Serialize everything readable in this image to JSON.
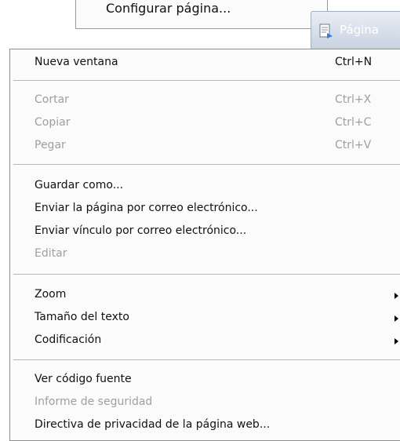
{
  "prev_menu": {
    "item_label": "Configurar página..."
  },
  "toolbar": {
    "page_button_label": "Página",
    "page_button_icon": "page-icon"
  },
  "menu": {
    "items": [
      {
        "label": "Nueva ventana",
        "shortcut": "Ctrl+N",
        "enabled": true
      },
      {
        "label": "Cortar",
        "shortcut": "Ctrl+X",
        "enabled": false
      },
      {
        "label": "Copiar",
        "shortcut": "Ctrl+C",
        "enabled": false
      },
      {
        "label": "Pegar",
        "shortcut": "Ctrl+V",
        "enabled": false
      },
      {
        "label": "Guardar como...",
        "enabled": true
      },
      {
        "label": "Enviar la página por correo electrónico...",
        "enabled": true
      },
      {
        "label": "Enviar vínculo por correo electrónico...",
        "enabled": true
      },
      {
        "label": "Editar",
        "enabled": false
      },
      {
        "label": "Zoom",
        "submenu": true,
        "enabled": true
      },
      {
        "label": "Tamaño del texto",
        "submenu": true,
        "enabled": true
      },
      {
        "label": "Codificación",
        "submenu": true,
        "enabled": true
      },
      {
        "label": "Ver código fuente",
        "enabled": true
      },
      {
        "label": "Informe de seguridad",
        "enabled": false
      },
      {
        "label": "Directiva de privacidad de la página web...",
        "enabled": true
      }
    ]
  },
  "colors": {
    "menu_background": "#fbfbfb",
    "text": "#111111",
    "disabled_text": "#9f9f9f",
    "separator": "#b9b9b9"
  }
}
